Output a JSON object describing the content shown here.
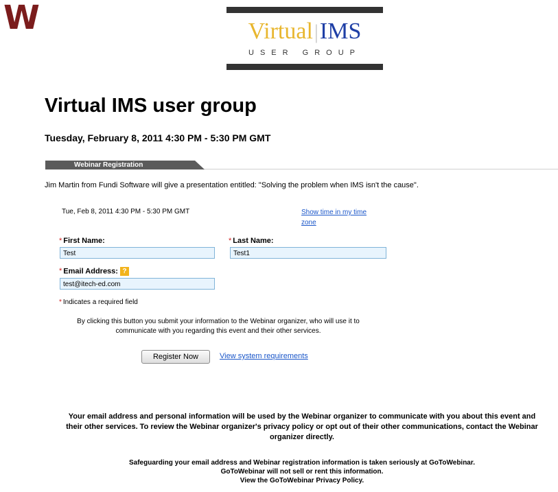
{
  "branding": {
    "w_logo": "W",
    "ims_logo_word_1": "Virtual",
    "ims_logo_separator": "|",
    "ims_logo_word_2": "IMS",
    "ims_logo_subtitle": "USER GROUP"
  },
  "page": {
    "title": "Virtual IMS user group",
    "event_datetime": "Tuesday, February 8, 2011 4:30 PM - 5:30 PM GMT"
  },
  "section": {
    "tab_label": "Webinar Registration",
    "intro": "Jim Martin from Fundi Software will give a presentation entitled: \"Solving the problem when IMS isn't the cause\"."
  },
  "form": {
    "session_datetime": "Tue, Feb 8, 2011 4:30 PM - 5:30 PM GMT",
    "timezone_link": "Show time in my time zone",
    "required_marker": "*",
    "first_name": {
      "label": "First Name:",
      "value": "Test"
    },
    "last_name": {
      "label": "Last Name:",
      "value": "Test1"
    },
    "email": {
      "label": "Email Address:",
      "value": "test@itech-ed.com",
      "help_icon": "?"
    },
    "required_note": "Indicates a required field",
    "consent_text": "By clicking this button you submit your information to the Webinar organizer, who will use it to communicate with you regarding this event and their other services.",
    "register_button": "Register Now",
    "system_requirements_link": "View system requirements"
  },
  "footer": {
    "privacy_notice": "Your email address and personal information will be used by the Webinar organizer to communicate with you about this event and their other services. To review the Webinar organizer's privacy policy or opt out of their other communications, contact the Webinar organizer directly.",
    "safeguard_line_1": "Safeguarding your email address and Webinar registration information is taken seriously at GoToWebinar.",
    "safeguard_line_2": "GoToWebinar will not sell or rent this information.",
    "privacy_policy_link": "View the GoToWebinar Privacy Policy."
  },
  "colors": {
    "w_logo": "#7b1c1c",
    "ims_gold": "#e8b62e",
    "ims_blue": "#1f3fa6",
    "link": "#1a56c9",
    "field_bg": "#e8f4fd",
    "field_border": "#7fb3d8",
    "tab_bg": "#5b5b5b",
    "required": "#d02020",
    "help_icon": "#f2b31c"
  }
}
